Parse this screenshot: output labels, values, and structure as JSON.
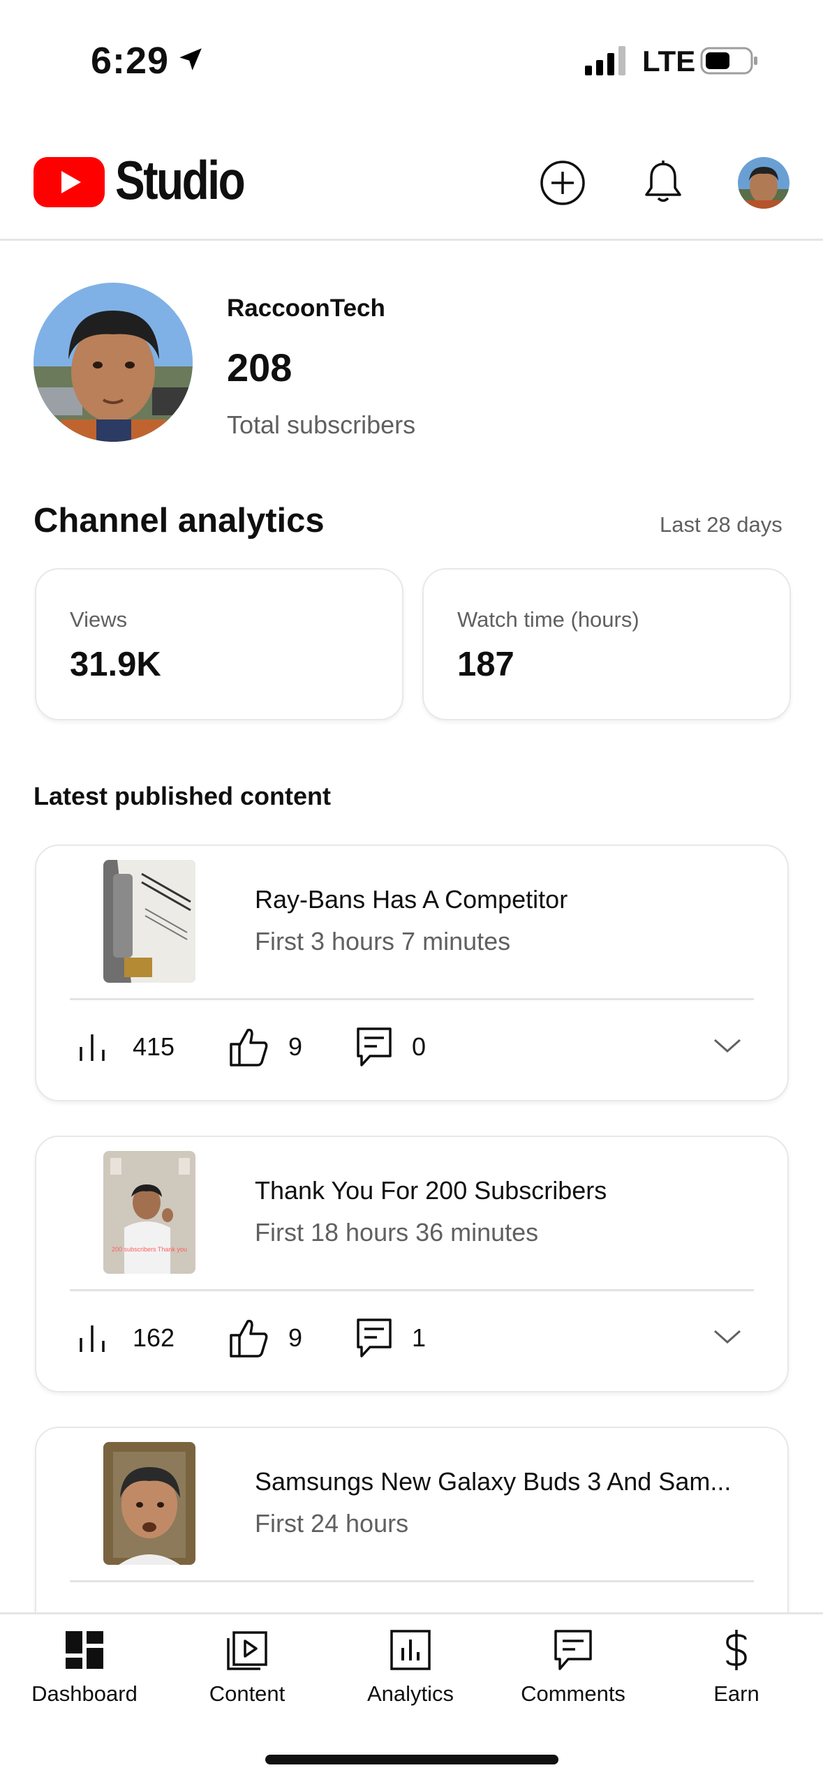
{
  "status_bar": {
    "time": "6:29",
    "network": "LTE",
    "icons": [
      "location-arrow-icon",
      "signal-icon",
      "battery-icon"
    ]
  },
  "header": {
    "app_name": "Studio",
    "icons": [
      "youtube-logo-icon",
      "create-icon",
      "bell-icon",
      "account-avatar"
    ]
  },
  "channel": {
    "name": "RaccoonTech",
    "subscribers": "208",
    "subscribers_label": "Total subscribers"
  },
  "analytics": {
    "title": "Channel analytics",
    "range": "Last 28 days",
    "cards": [
      {
        "label": "Views",
        "value": "31.9K"
      },
      {
        "label": "Watch time (hours)",
        "value": "187"
      }
    ]
  },
  "latest": {
    "title": "Latest published content",
    "items": [
      {
        "title": "Ray-Bans Has A Competitor",
        "subtitle": "First 3 hours 7 minutes",
        "views": "415",
        "likes": "9",
        "comments": "0"
      },
      {
        "title": "Thank You For 200 Subscribers",
        "subtitle": "First 18 hours 36 minutes",
        "views": "162",
        "likes": "9",
        "comments": "1",
        "thumb_caption": "200 subscribers Thank you"
      },
      {
        "title": "Samsungs New Galaxy Buds 3 And Sam...",
        "subtitle": "First 24 hours"
      }
    ]
  },
  "bottom_nav": [
    {
      "label": "Dashboard",
      "icon": "dashboard-icon"
    },
    {
      "label": "Content",
      "icon": "content-icon"
    },
    {
      "label": "Analytics",
      "icon": "analytics-icon"
    },
    {
      "label": "Comments",
      "icon": "comments-icon"
    },
    {
      "label": "Earn",
      "icon": "dollar-icon"
    }
  ],
  "colors": {
    "brand_red": "#ff0000",
    "text_primary": "#0f0f0f",
    "text_secondary": "#606060"
  }
}
